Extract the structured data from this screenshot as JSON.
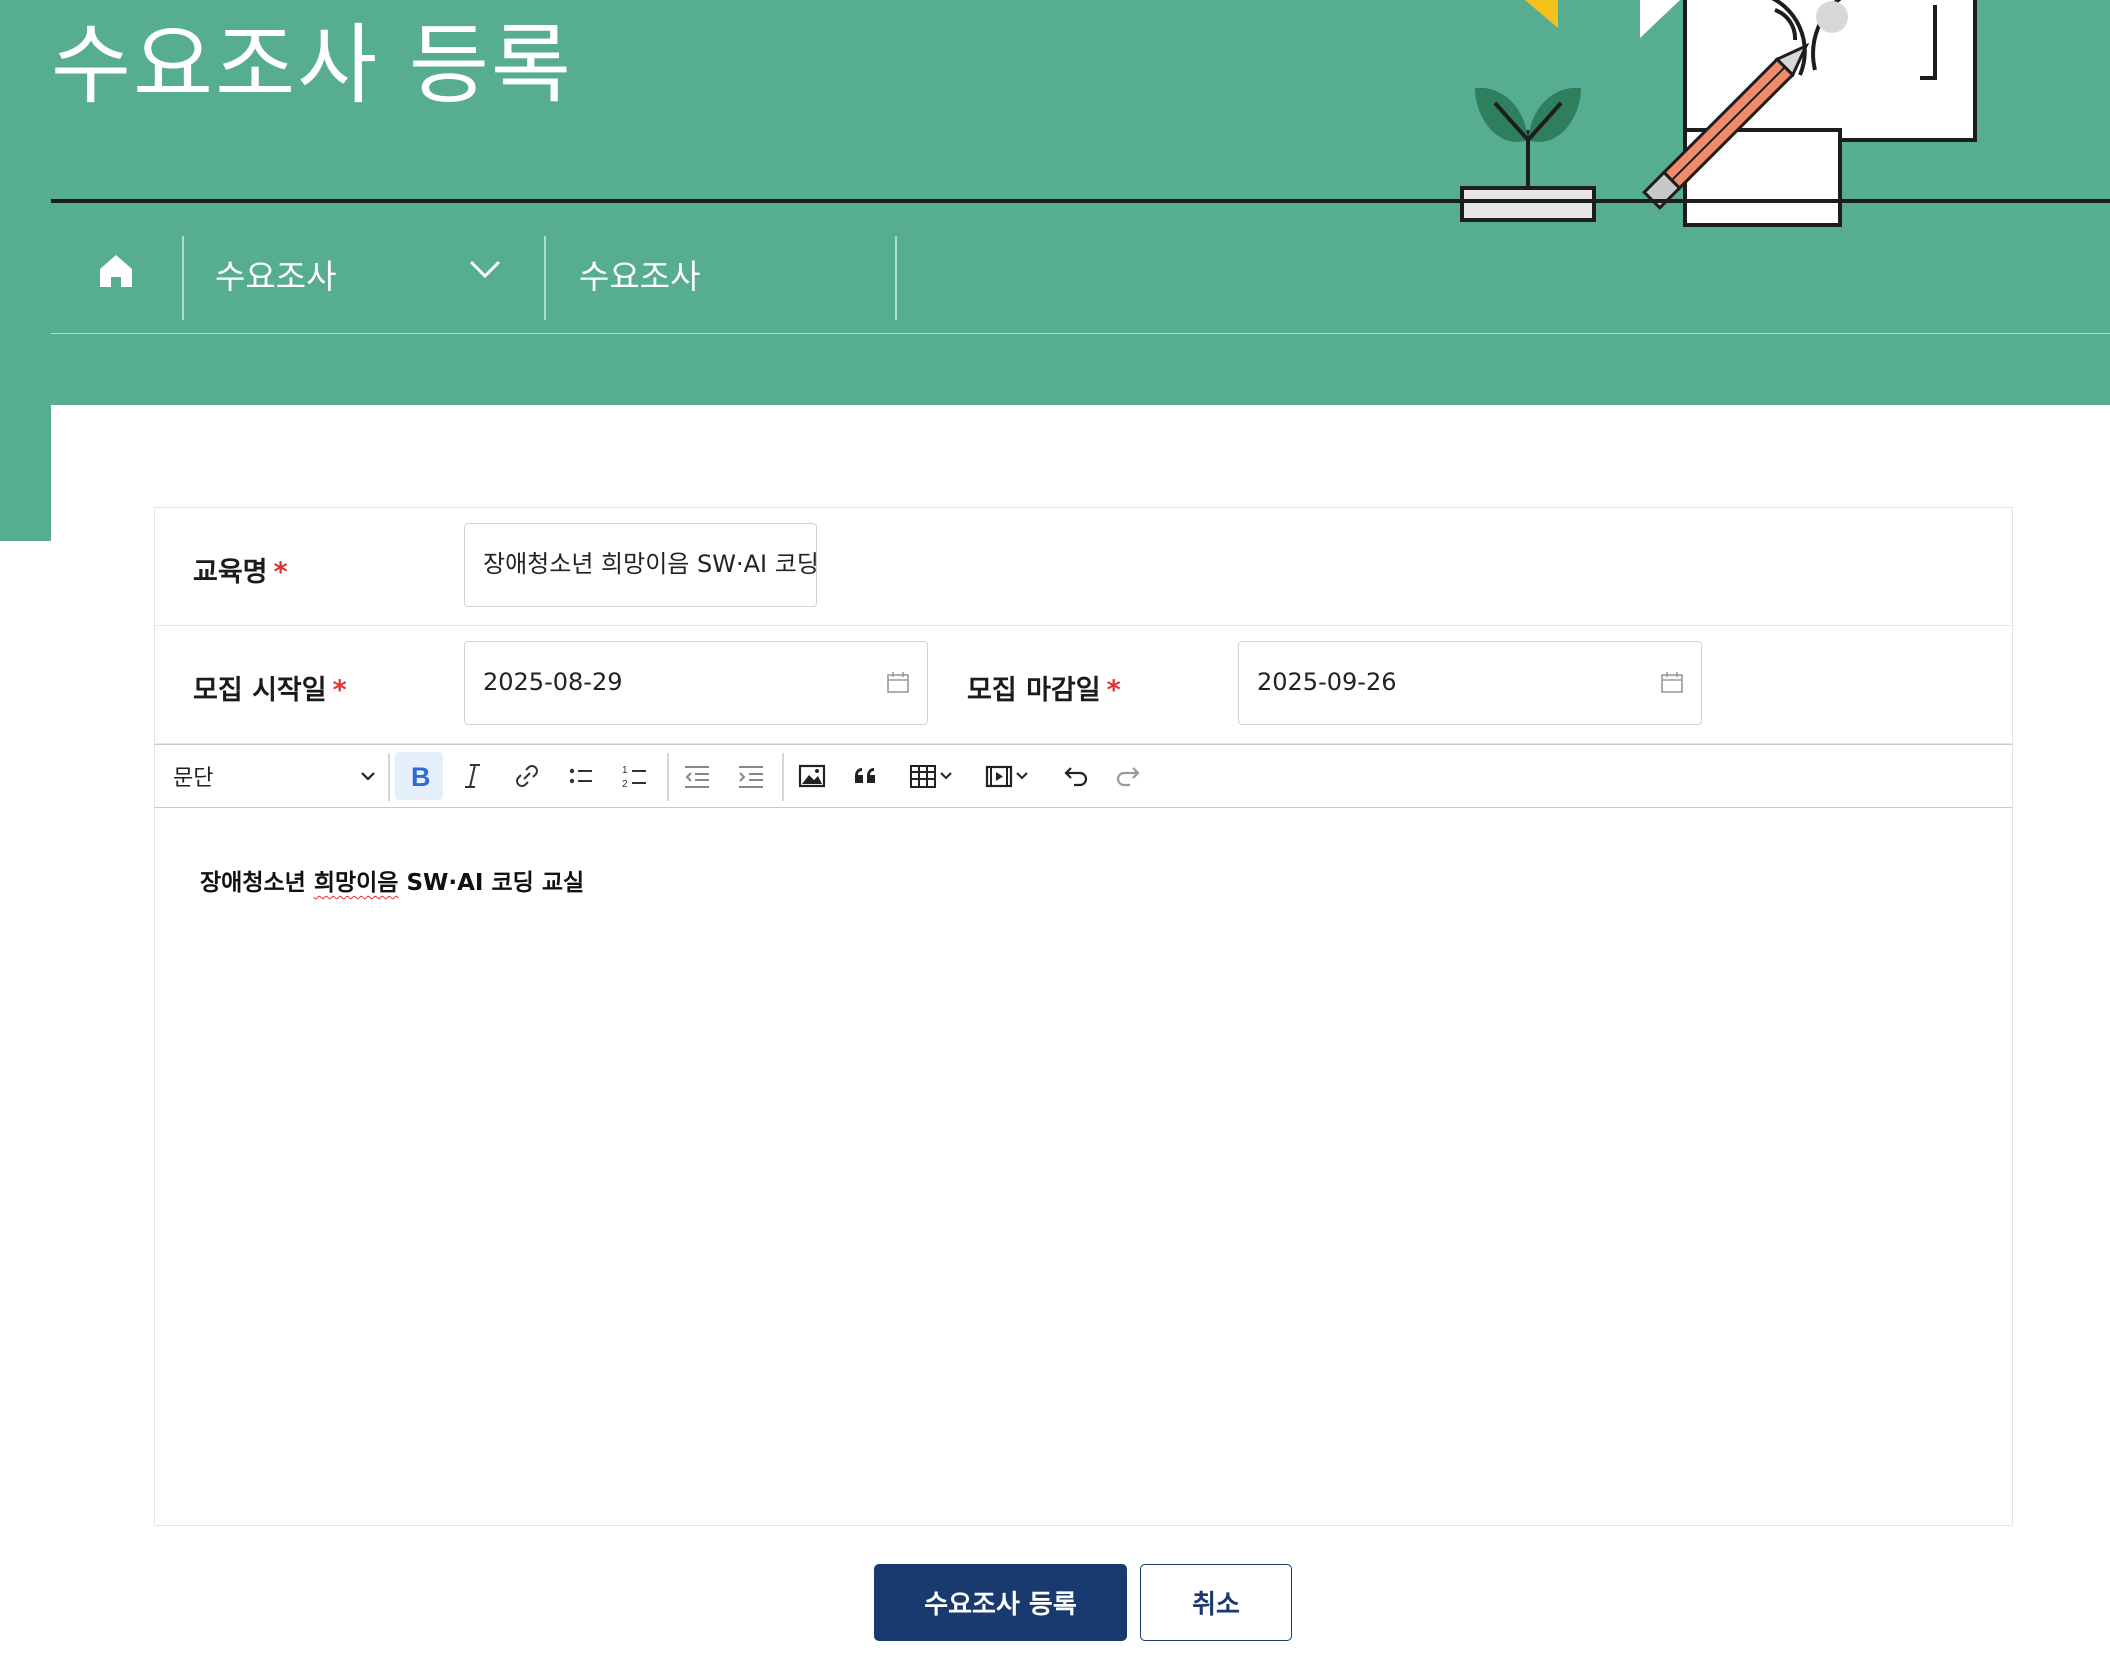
{
  "header": {
    "title": "수요조사 등록",
    "bg_color": "#56ad92"
  },
  "breadcrumb": {
    "home_icon": "home-icon",
    "level1": "수요조사",
    "level2": "수요조사"
  },
  "form": {
    "course_name": {
      "label": "교육명",
      "required_mark": "*",
      "value": "장애청소년 희망이음 SW·AI 코딩 교실"
    },
    "start_date": {
      "label": "모집 시작일",
      "required_mark": "*",
      "value": "2025-08-29"
    },
    "end_date": {
      "label": "모집 마감일",
      "required_mark": "*",
      "value": "2025-09-26"
    }
  },
  "editor": {
    "paragraph_select": "문단",
    "toolbar_icons": [
      "bold-icon",
      "italic-icon",
      "link-icon",
      "bulleted-list-icon",
      "numbered-list-icon",
      "outdent-icon",
      "indent-icon",
      "image-icon",
      "quote-icon",
      "table-icon",
      "media-icon",
      "undo-icon",
      "redo-icon"
    ],
    "content_part1": "장애청소년 ",
    "content_misspelled": "희망이음",
    "content_part2": " SW·AI 코딩 교실"
  },
  "actions": {
    "submit_label": "수요조사 등록",
    "cancel_label": "취소",
    "primary_color": "#183a6e"
  }
}
